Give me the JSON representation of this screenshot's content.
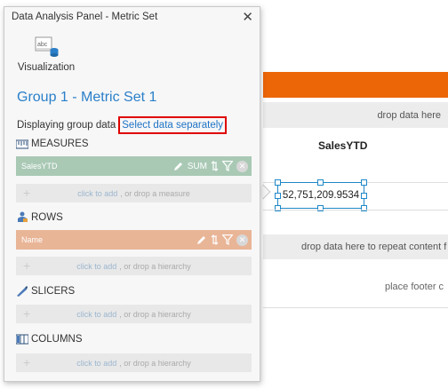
{
  "panel": {
    "title": "Data Analysis Panel - Metric Set",
    "visualization_label": "Visualization",
    "group_title": "Group 1 - Metric Set 1",
    "displaying_label": "Displaying group data",
    "select_link": "Select data separately"
  },
  "measures": {
    "header": "MEASURES",
    "field_name": "SalesYTD",
    "aggregate": "SUM",
    "drop_link": "click to add",
    "drop_text": ", or drop a measure"
  },
  "rows": {
    "header": "ROWS",
    "field_name": "Name",
    "drop_link": "click to add",
    "drop_text": ", or drop a hierarchy"
  },
  "slicers": {
    "header": "SLICERS",
    "drop_link": "click to add",
    "drop_text": ", or drop a hierarchy"
  },
  "columns": {
    "header": "COLUMNS",
    "drop_link": "click to add",
    "drop_text": ", or drop a hierarchy"
  },
  "report": {
    "drop_top": "drop data here",
    "header_label": "SalesYTD",
    "cell_value": "52,751,209.9534",
    "drop_repeat": "drop data here to repeat content f",
    "footer_text": "place footer c"
  },
  "colors": {
    "accent_orange": "#ec6608",
    "measure_green": "#a9c9b5",
    "row_orange": "#e9b597",
    "link_blue": "#1f73c5",
    "highlight_red": "#e00000"
  }
}
